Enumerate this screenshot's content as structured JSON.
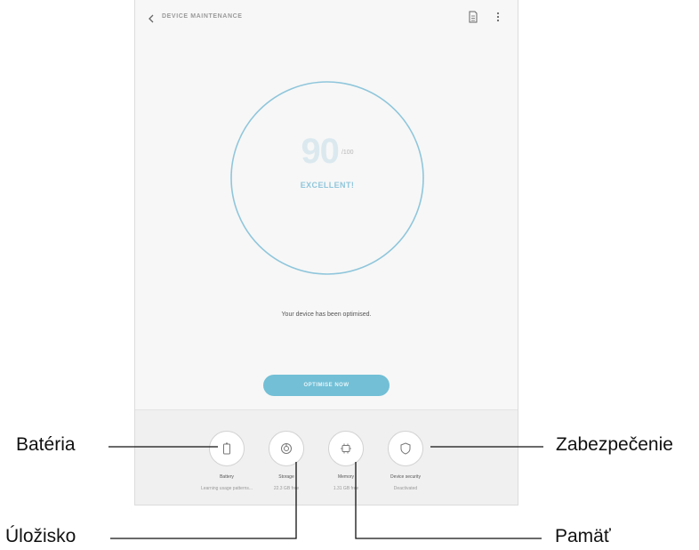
{
  "app_bar": {
    "title": "DEVICE MAINTENANCE"
  },
  "score": {
    "value": "90",
    "max": "/100",
    "rating": "EXCELLENT!",
    "fraction": 0.9
  },
  "status_text": "Your device has been optimised.",
  "optimize_button": "OPTIMISE NOW",
  "items": [
    {
      "label": "Battery",
      "sub": "Learning usage patterns...",
      "icon": "battery-icon"
    },
    {
      "label": "Storage",
      "sub": "22.3 GB free",
      "icon": "storage-icon"
    },
    {
      "label": "Memory",
      "sub": "1.31 GB free",
      "icon": "memory-icon"
    },
    {
      "label": "Device security",
      "sub": "Deactivated",
      "icon": "shield-icon"
    }
  ],
  "callouts": {
    "battery": "Batéria",
    "storage": "Úložisko",
    "memory": "Pamäť",
    "security": "Zabezpečenie"
  },
  "colors": {
    "accent": "#72bfd6",
    "gauge_ring": "#8fc6db"
  }
}
